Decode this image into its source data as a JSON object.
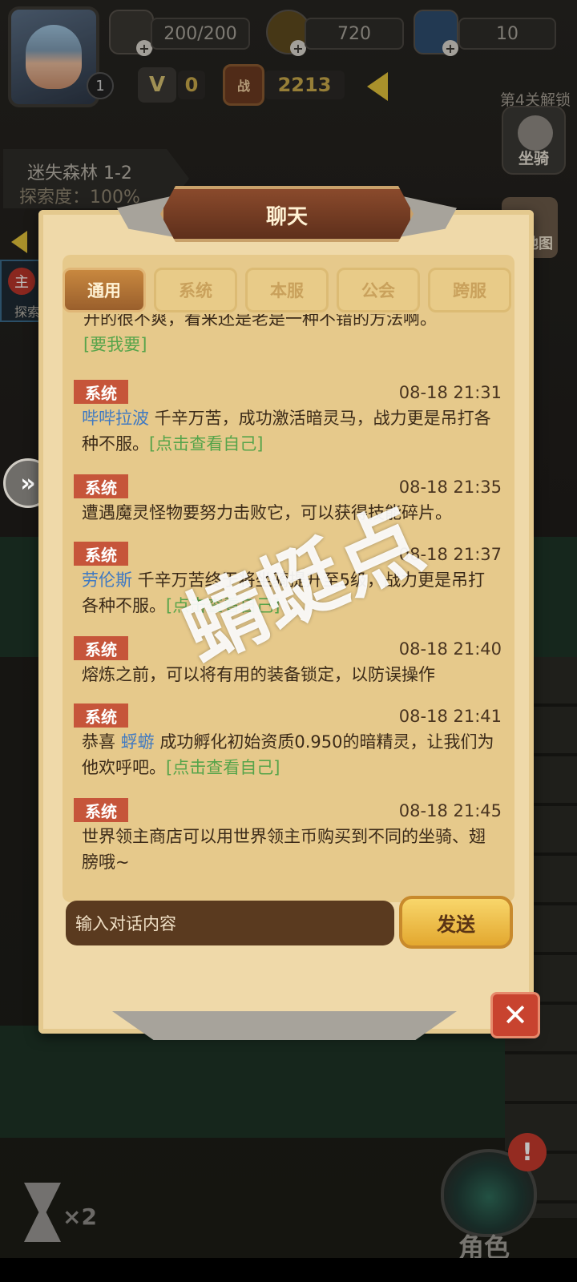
{
  "hud": {
    "level": "1",
    "stamina": "200/200",
    "gold": "720",
    "diamonds": "10",
    "vip": "0",
    "vip_letter": "V",
    "battle_power_label": "战",
    "battle_power": "2213",
    "unlock_text": "第4关解锁",
    "mount_label": "坐骑",
    "map_label": "地图",
    "stage_name": "迷失森林 1-2",
    "stage_progress": "探索度：100%",
    "quest_dot": "主",
    "quest_label": "探索",
    "speed": "×2",
    "role_label": "角色",
    "alert": "!"
  },
  "chat": {
    "title": "聊天",
    "tabs": [
      {
        "label": "通用",
        "active": true
      },
      {
        "label": "系统",
        "active": false
      },
      {
        "label": "本服",
        "active": false
      },
      {
        "label": "公会",
        "active": false
      },
      {
        "label": "跨服",
        "active": false
      }
    ],
    "partial_text_top": "开的很不爽，看来还是老是一种不错的方法啊。",
    "partial_link": "[要我要]",
    "messages": [
      {
        "badge": "系统",
        "time": "08-18 21:31",
        "name": "哔哔拉波",
        "text": " 千辛万苦，成功激活暗灵马，战力更是吊打各种不服。",
        "link": "[点击查看自己]"
      },
      {
        "badge": "系统",
        "time": "08-18 21:35",
        "name": "",
        "text": "遭遇魔灵怪物要努力击败它，可以获得技能碎片。",
        "link": ""
      },
      {
        "badge": "系统",
        "time": "08-18 21:37",
        "name": "劳伦斯",
        "text": " 千辛万苦终于将坐骑提升至5级，战力更是吊打各种不服。",
        "link": "[点击查看自己]"
      },
      {
        "badge": "系统",
        "time": "08-18 21:40",
        "name": "",
        "text": "熔炼之前，可以将有用的装备锁定，以防误操作",
        "link": ""
      },
      {
        "badge": "系统",
        "time": "08-18 21:41",
        "name": "蜉蝣",
        "text": " 成功孵化初始资质0.950的暗精灵，让我们为他欢呼吧。",
        "link": "[点击查看自己]",
        "prefix": "恭喜 "
      },
      {
        "badge": "系统",
        "time": "08-18 21:45",
        "name": "",
        "text": "世界领主商店可以用世界领主币购买到不同的坐骑、翅膀哦~",
        "link": ""
      }
    ],
    "input_placeholder": "输入对话内容",
    "send_label": "发送",
    "close_label": "✕"
  },
  "watermark": "蜻蜓点",
  "colors": {
    "badge": "#c6553a",
    "name": "#3f79c2",
    "link": "#56a44a",
    "parchment": "#efd9a9",
    "send_button": "#f8d66b"
  }
}
